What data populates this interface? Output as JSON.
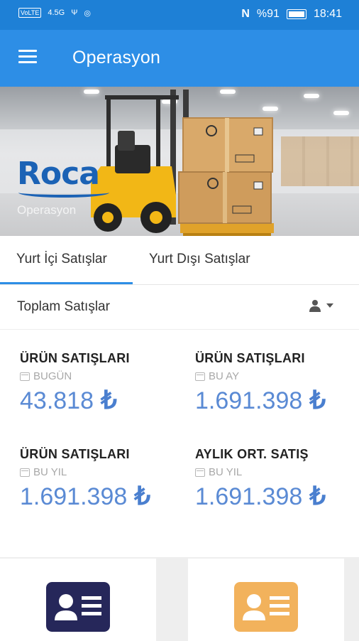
{
  "status_bar": {
    "signal_badge": "VoLTE",
    "network": "4.5G",
    "battery": "%91",
    "time": "18:41"
  },
  "app_bar": {
    "title": "Operasyon"
  },
  "banner": {
    "logo_text": "Roca",
    "subtitle": "Operasyon"
  },
  "tabs": [
    {
      "label": "Yurt İçi Satışlar",
      "active": true
    },
    {
      "label": "Yurt Dışı Satışlar",
      "active": false
    }
  ],
  "filter": {
    "title": "Toplam Satışlar"
  },
  "stats": [
    {
      "title": "ÜRÜN SATIŞLARI",
      "period": "BUGÜN",
      "value": "43.818",
      "currency": "₺"
    },
    {
      "title": "ÜRÜN SATIŞLARI",
      "period": "BU AY",
      "value": "1.691.398",
      "currency": "₺"
    },
    {
      "title": "ÜRÜN SATIŞLARI",
      "period": "BU YIL",
      "value": "1.691.398",
      "currency": "₺"
    },
    {
      "title": "AYLIK ORT. SATIŞ",
      "period": "BU YIL",
      "value": "1.691.398",
      "currency": "₺"
    }
  ],
  "colors": {
    "status_bar": "#1e80d6",
    "app_bar": "#2d8ee6",
    "value_text": "#5a8ad4",
    "card1_icon": "#26275a",
    "card2_icon": "#f2b25c"
  },
  "cards": [
    {
      "icon": "contact-card-icon"
    },
    {
      "icon": "contact-card-icon"
    }
  ]
}
